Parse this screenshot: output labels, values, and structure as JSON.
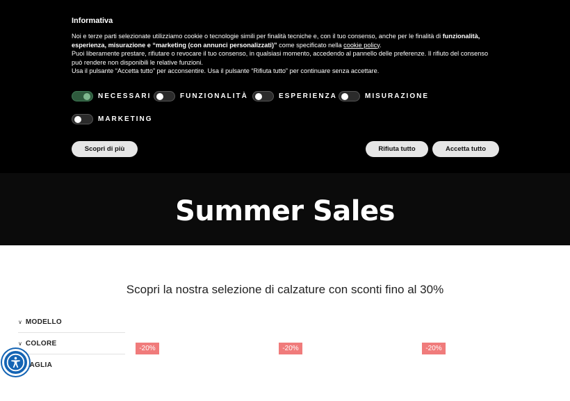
{
  "cookie": {
    "title": "Informativa",
    "text_line1_a": "Noi e terze parti selezionate utilizziamo cookie o tecnologie simili per finalità tecniche e, con il tuo consenso, anche per le finalità di ",
    "text_line1_b": "funzionalità, esperienza, misurazione e “marketing (con annunci personalizzati)”",
    "text_line1_c": " come specificato nella ",
    "cookie_policy_link": "cookie policy",
    "text_line1_d": ".",
    "text_line2": "Puoi liberamente prestare, rifiutare o revocare il tuo consenso, in qualsiasi momento, accedendo al pannello delle preferenze. Il rifiuto del consenso può rendere non disponibili le relative funzioni.",
    "text_line3": "Usa il pulsante “Accetta tutto” per acconsentire. Usa il pulsante “Rifiuta tutto” per continuare senza accettare.",
    "toggles": [
      {
        "label": "NECESSARI",
        "on": true
      },
      {
        "label": "FUNZIONALITÀ",
        "on": false
      },
      {
        "label": "ESPERIENZA",
        "on": false
      },
      {
        "label": "MISURAZIONE",
        "on": false
      },
      {
        "label": "MARKETING",
        "on": false
      }
    ],
    "learn_more_label": "Scopri di più",
    "reject_label": "Rifiuta tutto",
    "accept_label": "Accetta tutto"
  },
  "hero": {
    "title": "Summer Sales"
  },
  "main": {
    "subtitle": "Scopri la nostra selezione di calzature con sconti fino al 30%"
  },
  "filters": [
    {
      "label": "MODELLO"
    },
    {
      "label": "COLORE"
    },
    {
      "label": "TAGLIA"
    }
  ],
  "products": [
    {
      "discount": "-20%"
    },
    {
      "discount": "-20%"
    },
    {
      "discount": "-20%"
    }
  ],
  "colors": {
    "badge": "#f07b7b",
    "accessibility": "#1464b4",
    "toggle_on": "#2e5a3d"
  }
}
